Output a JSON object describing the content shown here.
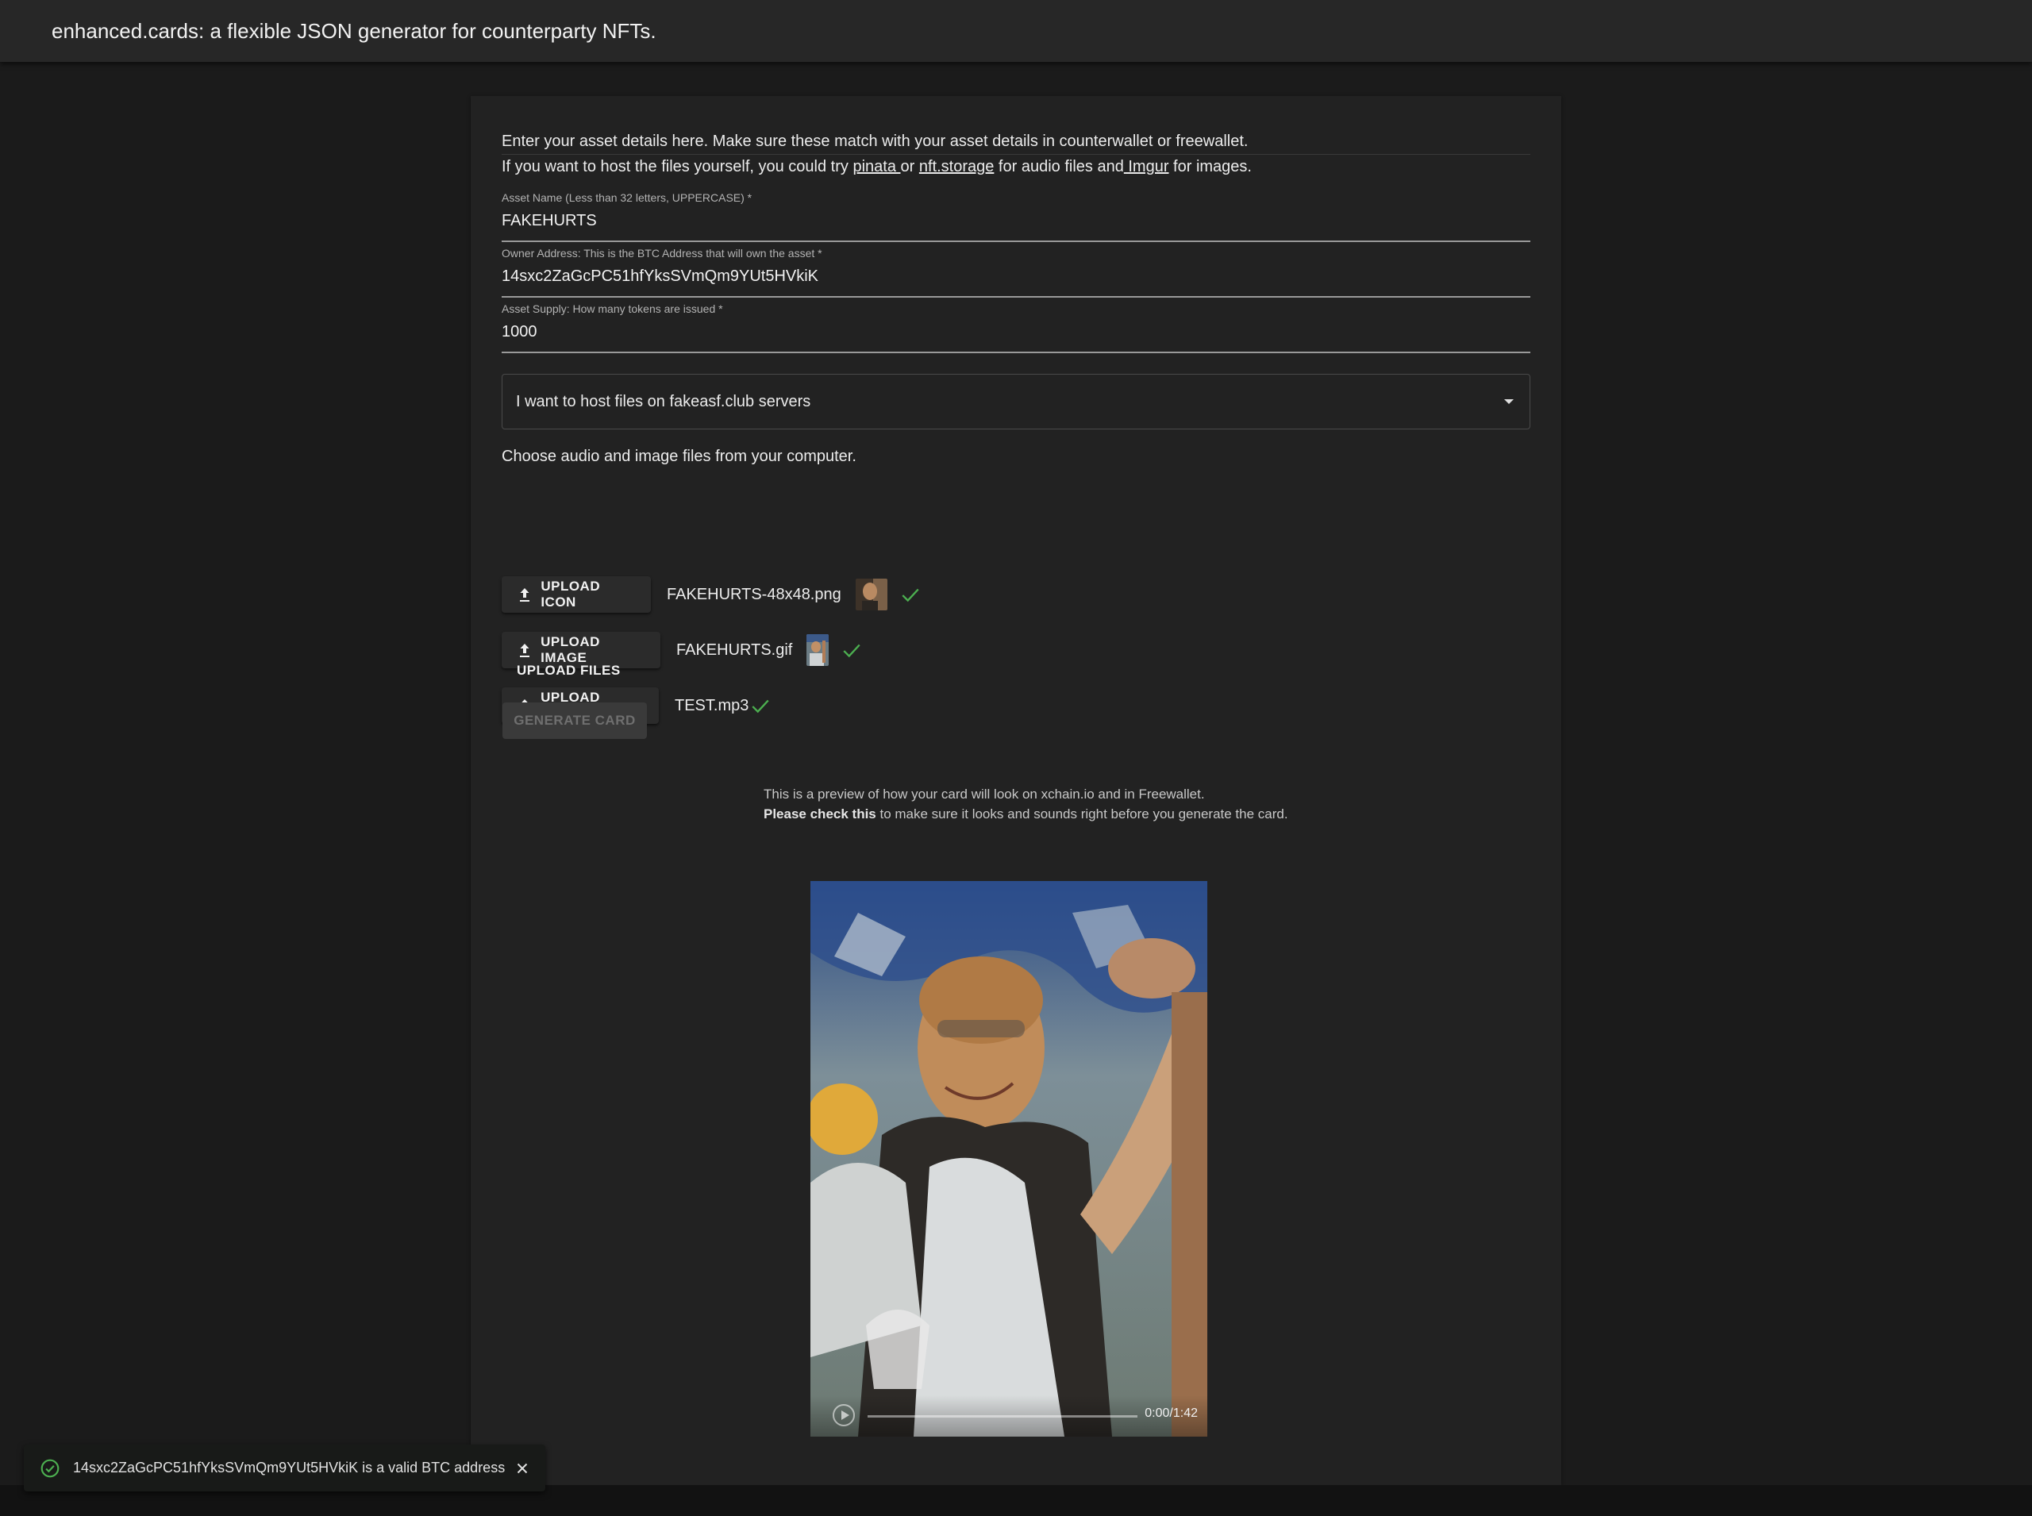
{
  "appbar": {
    "title": "enhanced.cards: a flexible JSON generator for counterparty NFTs."
  },
  "intro": {
    "line1": "Enter your asset details here. Make sure these match with your asset details in counterwallet or freewallet.",
    "line2_prefix": "If you want to host the files yourself, you could try ",
    "link_pinata": "pinata ",
    "or_text": "or ",
    "link_nftstorage": "nft.storage",
    "mid_text": " for audio files and",
    "link_imgur": " Imgur",
    "suffix": " for images."
  },
  "fields": {
    "asset_name": {
      "label": "Asset Name (Less than 32 letters, UPPERCASE) *",
      "value": "FAKEHURTS"
    },
    "owner_address": {
      "label": "Owner Address: This is the BTC Address that will own the asset *",
      "value": "14sxc2ZaGcPC51hfYksSVmQm9YUt5HVkiK"
    },
    "asset_supply": {
      "label": "Asset Supply: How many tokens are issued *",
      "value": "1000"
    }
  },
  "hosting_select": {
    "value": "I want to host files on fakeasf.club servers"
  },
  "choose_text": "Choose audio and image files from your computer.",
  "uploads": [
    {
      "button": "UPLOAD ICON",
      "filename": "FAKEHURTS-48x48.png",
      "icon": "upload-icon",
      "status": "check-icon"
    },
    {
      "button": "UPLOAD IMAGE",
      "filename": "FAKEHURTS.gif",
      "icon": "upload-icon",
      "status": "check-icon"
    },
    {
      "button": "UPLOAD AUDIO",
      "filename": "TEST.mp3",
      "icon": "upload-icon",
      "status": "check-icon"
    }
  ],
  "upload_files_label": "UPLOAD FILES",
  "generate_label": "GENERATE CARD",
  "preview": {
    "line1": "This is a preview of how your card will look on xchain.io and in Freewallet.",
    "bold": "Please check this",
    "line2_rest": " to make sure it looks and sounds right before you generate the card."
  },
  "player": {
    "time": "0:00/1:42"
  },
  "snackbar": {
    "message": "14sxc2ZaGcPC51hfYksSVmQm9YUt5HVkiK is a valid BTC address"
  },
  "colors": {
    "accent_success": "#4caf50",
    "background": "#1b1b1b",
    "panel": "#222222",
    "appbar": "#272727"
  }
}
